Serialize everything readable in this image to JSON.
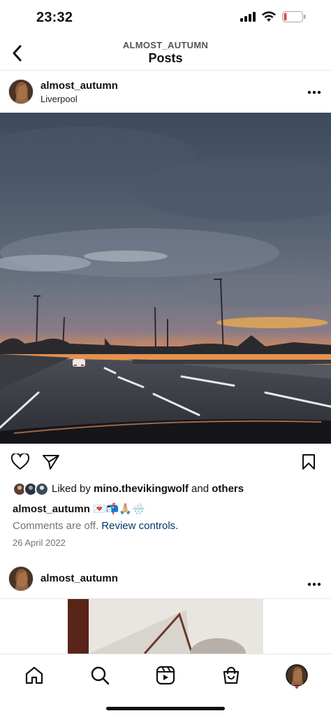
{
  "status_bar": {
    "time": "23:32",
    "battery_color": "#e5484d"
  },
  "header": {
    "subtitle": "ALMOST_AUTUMN",
    "title": "Posts"
  },
  "post": {
    "username": "almost_autumn",
    "location": "Liverpool",
    "liked_prefix": "Liked by ",
    "liked_user": "mino.thevikingwolf",
    "liked_and": " and ",
    "liked_others": "others",
    "caption_user": "almost_autumn",
    "caption_emojis": "💌📬🙏🏼🌧️",
    "comments_off": "Comments are off. ",
    "review_controls": "Review controls.",
    "date": "26 April 2022"
  },
  "next_post": {
    "username": "almost_autumn"
  },
  "icons": {
    "back": "chevron-left-icon",
    "like": "heart-icon",
    "share": "paper-plane-icon",
    "save": "bookmark-icon",
    "more": "more-horizontal-icon",
    "tabs": [
      "home-icon",
      "search-icon",
      "reels-icon",
      "shop-icon",
      "profile-avatar"
    ]
  },
  "colors": {
    "link": "#00376b",
    "secondary_text": "#737373",
    "notification_dot": "#e0245e"
  }
}
